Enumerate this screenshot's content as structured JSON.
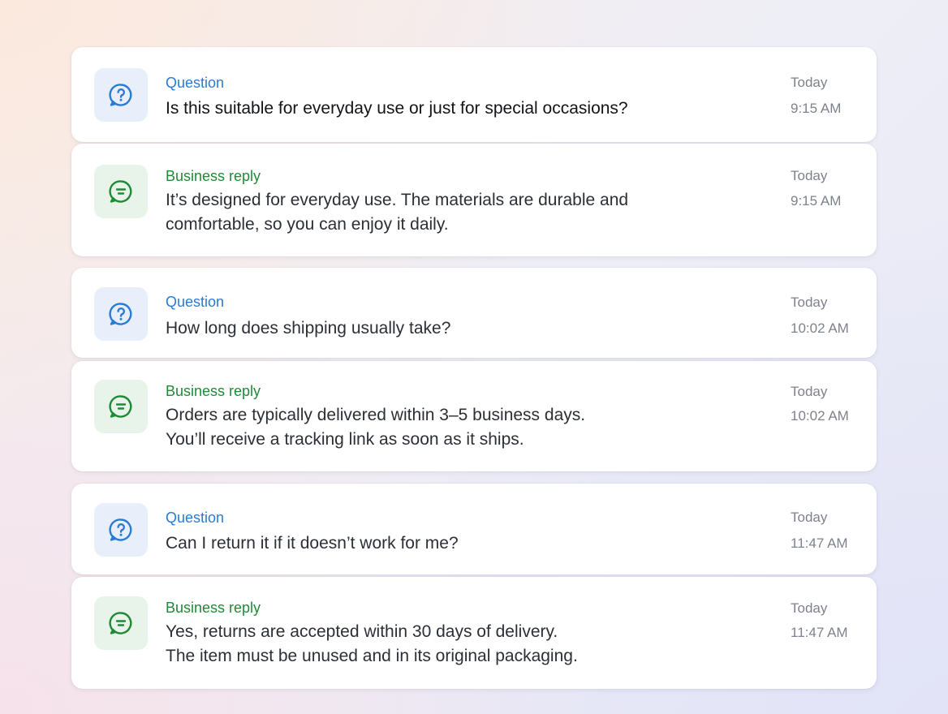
{
  "threads": [
    {
      "question": {
        "kind_label": "Question",
        "text": "Is this suitable for everyday use or just for special occasions?",
        "day": "Today",
        "time": "9:15 AM"
      },
      "reply": {
        "kind_label": "Business reply",
        "text": "It’s designed for everyday use. The materials are durable and\ncomfortable, so you can enjoy it daily.",
        "day": "Today",
        "time": "9:15 AM"
      }
    },
    {
      "question": {
        "kind_label": "Question",
        "text": "How long does shipping usually take?",
        "day": "Today",
        "time": "10:02 AM"
      },
      "reply": {
        "kind_label": "Business reply",
        "text": "Orders are typically delivered within 3–5 business days.\nYou’ll receive a tracking link as soon as it ships.",
        "day": "Today",
        "time": "10:02 AM"
      }
    },
    {
      "question": {
        "kind_label": "Question",
        "text": "Can I return it if it doesn’t work for me?",
        "day": "Today",
        "time": "11:47 AM"
      },
      "reply": {
        "kind_label": "Business reply",
        "text": "Yes, returns are accepted within 30 days of delivery.\nThe item must be unused and in its original packaging.",
        "day": "Today",
        "time": "11:47 AM"
      }
    }
  ],
  "icons": {
    "question": "question-bubble-icon",
    "reply": "chat-reply-icon"
  },
  "colors": {
    "question_accent": "#2a7bd3",
    "reply_accent": "#1f8a36",
    "question_icon_bg": "#e8effb",
    "reply_icon_bg": "#e8f3ea",
    "timestamp": "#7d828c"
  }
}
